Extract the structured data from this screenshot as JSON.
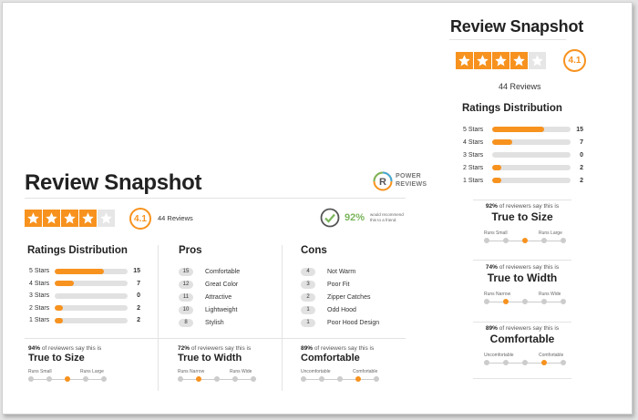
{
  "large": {
    "title": "Review Snapshot",
    "rating": "4.1",
    "stars_filled": 4.1,
    "review_count": "44 Reviews",
    "recommend_pct": "92%",
    "recommend_text_1": "would recommend",
    "recommend_text_2": "this to a friend.",
    "logo_line1": "POWER",
    "logo_line2": "REVIEWS",
    "dist_title": "Ratings Distribution",
    "distribution": [
      {
        "label": "5 Stars",
        "count": "15",
        "fraction": 0.68
      },
      {
        "label": "4 Stars",
        "count": "7",
        "fraction": 0.26
      },
      {
        "label": "3 Stars",
        "count": "0",
        "fraction": 0
      },
      {
        "label": "2 Stars",
        "count": "2",
        "fraction": 0.11
      },
      {
        "label": "1 Stars",
        "count": "2",
        "fraction": 0.11
      }
    ],
    "pros_title": "Pros",
    "pros": [
      {
        "count": "15",
        "label": "Comfortable"
      },
      {
        "count": "12",
        "label": "Great Color"
      },
      {
        "count": "11",
        "label": "Attractive"
      },
      {
        "count": "10",
        "label": "Lightweight"
      },
      {
        "count": "8",
        "label": "Stylish"
      }
    ],
    "cons_title": "Cons",
    "cons": [
      {
        "count": "4",
        "label": "Not Warm"
      },
      {
        "count": "3",
        "label": "Poor Fit"
      },
      {
        "count": "2",
        "label": "Zipper Catches"
      },
      {
        "count": "1",
        "label": "Odd Hood"
      },
      {
        "count": "1",
        "label": "Poor Hood Design"
      }
    ],
    "fits": [
      {
        "pct": "94%",
        "suffix": " of reviewers say this is",
        "title": "True to Size",
        "left": "Runs Small",
        "right": "Runs Large",
        "selected": 2
      },
      {
        "pct": "72%",
        "suffix": " of reviewers say this is",
        "title": "True to Width",
        "left": "Runs Narrow",
        "right": "Runs Wide",
        "selected": 1
      },
      {
        "pct": "89%",
        "suffix": " of reviewers say this is",
        "title": "Comfortable",
        "left": "Uncomfortable",
        "right": "Comfortable",
        "selected": 3
      }
    ]
  },
  "small": {
    "title": "Review Snapshot",
    "rating": "4.1",
    "review_count": "44 Reviews",
    "dist_title": "Ratings Distribution",
    "distribution": [
      {
        "label": "5 Stars",
        "count": "15",
        "fraction": 0.66
      },
      {
        "label": "4 Stars",
        "count": "7",
        "fraction": 0.25
      },
      {
        "label": "3 Stars",
        "count": "0",
        "fraction": 0
      },
      {
        "label": "2 Stars",
        "count": "2",
        "fraction": 0.12
      },
      {
        "label": "1 Stars",
        "count": "2",
        "fraction": 0.12
      }
    ],
    "fits": [
      {
        "pct": "92%",
        "suffix": " of reviewers say this is",
        "title": "True to Size",
        "left": "Runs Small",
        "right": "Runs Large",
        "selected": 2
      },
      {
        "pct": "74%",
        "suffix": " of reviewers say this is",
        "title": "True to Width",
        "left": "Runs Narrow",
        "right": "Runs Wide",
        "selected": 1
      },
      {
        "pct": "89%",
        "suffix": " of reviewers say this is",
        "title": "Comfortable",
        "left": "Uncomfortable",
        "right": "Comfortable",
        "selected": 3
      }
    ]
  },
  "colors": {
    "accent": "#f7921e",
    "recommend_green": "#7ab55c",
    "track": "#e1e1e1"
  },
  "icons": {
    "star": "star-icon",
    "check": "check-circle-icon",
    "logo": "power-reviews-logo"
  }
}
